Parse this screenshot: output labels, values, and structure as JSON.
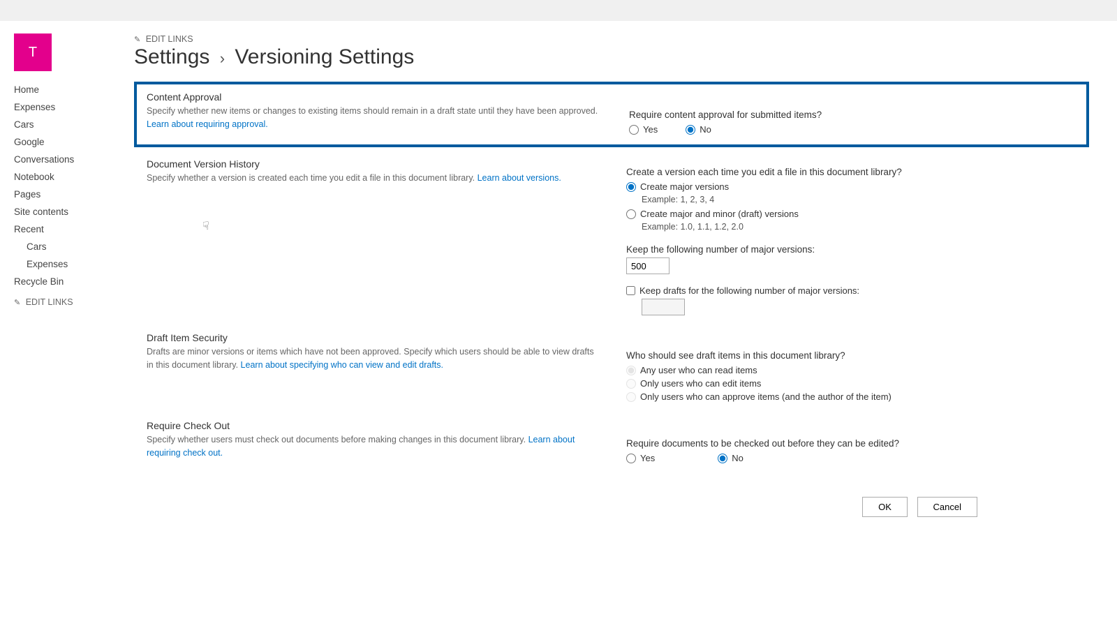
{
  "tile_letter": "T",
  "header": {
    "edit_links_label": "EDIT LINKS",
    "title_left": "Settings",
    "title_right": "Versioning Settings"
  },
  "sidebar": {
    "items": [
      {
        "label": "Home"
      },
      {
        "label": "Expenses"
      },
      {
        "label": "Cars"
      },
      {
        "label": "Google"
      },
      {
        "label": "Conversations"
      },
      {
        "label": "Notebook"
      },
      {
        "label": "Pages"
      },
      {
        "label": "Site contents"
      },
      {
        "label": "Recent"
      },
      {
        "label": "Cars",
        "indent": true
      },
      {
        "label": "Expenses",
        "indent": true
      },
      {
        "label": "Recycle Bin"
      }
    ],
    "edit_links_label": "EDIT LINKS"
  },
  "sections": {
    "content_approval": {
      "title": "Content Approval",
      "desc": "Specify whether new items or changes to existing items should remain in a draft state until they have been approved.  ",
      "link": "Learn about requiring approval.",
      "question": "Require content approval for submitted items?",
      "yes": "Yes",
      "no": "No"
    },
    "version_history": {
      "title": "Document Version History",
      "desc": "Specify whether a version is created each time you edit a file in this document library.  ",
      "link": "Learn about versions.",
      "question": "Create a version each time you edit a file in this document library?",
      "opt_major": "Create major versions",
      "ex_major": "Example: 1, 2, 3, 4",
      "opt_minor": "Create major and minor (draft) versions",
      "ex_minor": "Example: 1.0, 1.1, 1.2, 2.0",
      "keep_label": "Keep the following number of major versions:",
      "keep_value": "500",
      "keep_drafts_label": "Keep drafts for the following number of major versions:"
    },
    "draft_security": {
      "title": "Draft Item Security",
      "desc": "Drafts are minor versions or items which have not been approved. Specify which users should be able to view drafts in this document library.  ",
      "link": "Learn about specifying who can view and edit drafts.",
      "question": "Who should see draft items in this document library?",
      "opt_read": "Any user who can read items",
      "opt_edit": "Only users who can edit items",
      "opt_approve": "Only users who can approve items (and the author of the item)"
    },
    "require_checkout": {
      "title": "Require Check Out",
      "desc": "Specify whether users must check out documents before making changes in this document library.  ",
      "link": "Learn about requiring check out.",
      "question": "Require documents to be checked out before they can be edited?",
      "yes": "Yes",
      "no": "No"
    }
  },
  "buttons": {
    "ok": "OK",
    "cancel": "Cancel"
  }
}
